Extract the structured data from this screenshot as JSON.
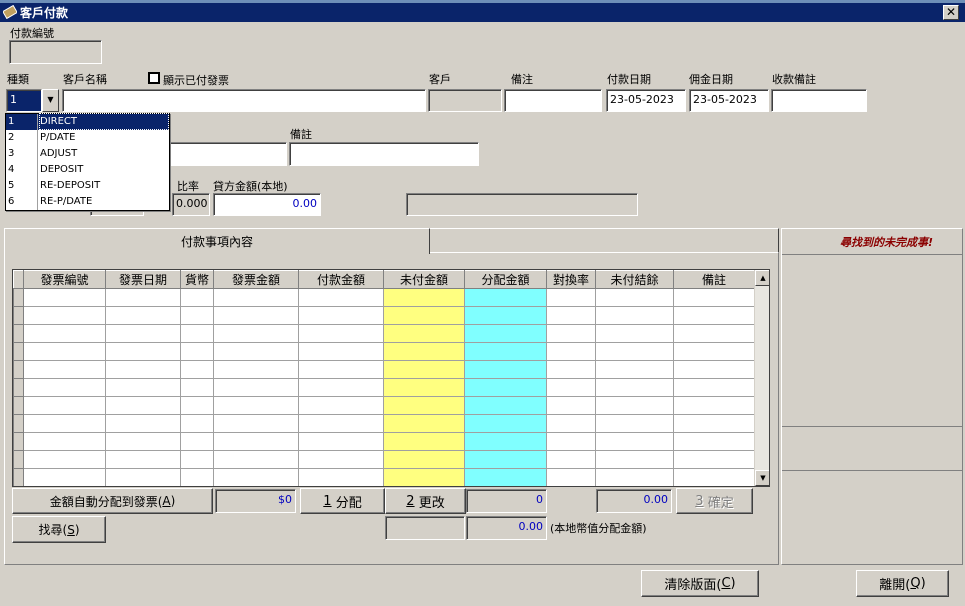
{
  "window": {
    "title": "客戶付款",
    "close_glyph": "✕"
  },
  "header": {
    "payment_no_label": "付款編號",
    "type_label": "種類",
    "type_value": "1",
    "customer_name_label": "客戶名稱",
    "show_paid_label": "顯示已付發票",
    "customer_label": "客戶",
    "remark_label": "備注",
    "pay_date_label": "付款日期",
    "pay_date_value": "23-05-2023",
    "commission_date_label": "佣金日期",
    "commission_date_value": "23-05-2023",
    "receipt_remark_label": "收款備註"
  },
  "type_dropdown": {
    "options": [
      {
        "code": "1",
        "label": "DIRECT"
      },
      {
        "code": "2",
        "label": "P/DATE"
      },
      {
        "code": "3",
        "label": "ADJUST"
      },
      {
        "code": "4",
        "label": "DEPOSIT"
      },
      {
        "code": "5",
        "label": "RE-DEPOSIT"
      },
      {
        "code": "6",
        "label": "RE-P/DATE"
      }
    ]
  },
  "row2": {
    "remark2_label": "備註"
  },
  "row3": {
    "rate_label": "比率",
    "rate_value": "0.000",
    "credit_amount_label": "貸方金額(本地)",
    "credit_amount_value": "0.00"
  },
  "tabs": {
    "tab1": "付款事項內容"
  },
  "side_panel": {
    "notice": "尋找到的未完成事!"
  },
  "grid": {
    "columns": [
      "發票編號",
      "發票日期",
      "貨幣",
      "發票金額",
      "付款金額",
      "未付金額",
      "分配金額",
      "對換率",
      "未付結餘",
      "備註"
    ],
    "row_count": 11
  },
  "footer": {
    "auto_allocate_label": "金額自動分配到發票(",
    "auto_allocate_key": "A",
    "total_value": "$0",
    "allocate_key": "1",
    "allocate_label": "分配",
    "change_key": "2",
    "change_label": "更改",
    "allocated_value": "0",
    "balance_value": "0.00",
    "confirm_key": "3",
    "confirm_label": "確定",
    "search_label": "找尋(",
    "search_key": "S",
    "local_allocated_value": "0.00",
    "local_allocated_label": "(本地幣值分配金額)",
    "clear_label": "清除版面(",
    "clear_key": "C",
    "leave_label": "離開(",
    "leave_key": "Q",
    "close_paren": ")"
  }
}
